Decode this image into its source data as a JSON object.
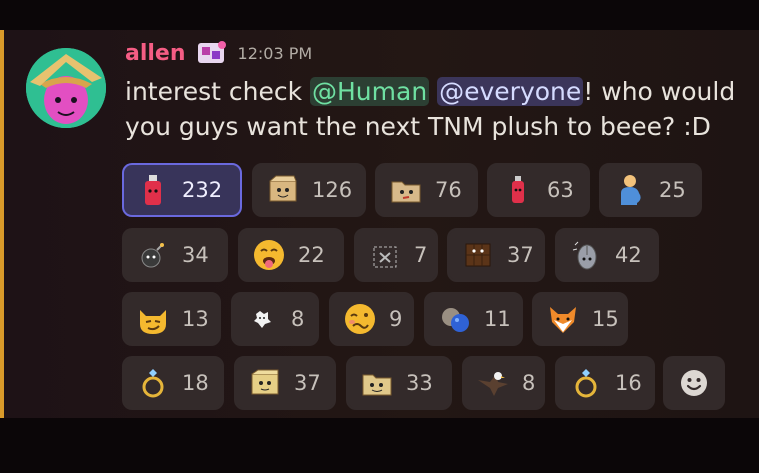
{
  "message": {
    "username": "allen",
    "timestamp": "12:03 PM",
    "text_before": "interest check ",
    "mention_human": "@Human",
    "text_between": " ",
    "mention_everyone": "@everyone",
    "text_after": "! who would you guys want the next TNM plush to beee? :D"
  },
  "colors": {
    "username": "#f55d84",
    "accent_bar": "#d99a2a",
    "selected_reaction_border": "#6a69de"
  },
  "reactions": [
    {
      "emoji": "red-bottle-icon",
      "count": "232",
      "selected": true
    },
    {
      "emoji": "box-character-icon",
      "count": "126"
    },
    {
      "emoji": "folder-character-icon",
      "count": "76"
    },
    {
      "emoji": "red-bottle-small-icon",
      "count": "63"
    },
    {
      "emoji": "pregnant-man-icon",
      "count": "25"
    },
    {
      "emoji": "bomb-character-icon",
      "count": "34"
    },
    {
      "emoji": "drooling-face-icon",
      "count": "22"
    },
    {
      "emoji": "missing-emoji-icon",
      "count": "7"
    },
    {
      "emoji": "chocolate-bar-icon",
      "count": "37"
    },
    {
      "emoji": "mouse-character-icon",
      "count": "42"
    },
    {
      "emoji": "smirking-cat-icon",
      "count": "13"
    },
    {
      "emoji": "white-blob-icon",
      "count": "8"
    },
    {
      "emoji": "woozy-face-icon",
      "count": "9"
    },
    {
      "emoji": "planets-icon",
      "count": "11"
    },
    {
      "emoji": "fox-face-icon",
      "count": "15"
    },
    {
      "emoji": "ring-icon",
      "count": "18"
    },
    {
      "emoji": "box-face-icon",
      "count": "37"
    },
    {
      "emoji": "folder-face-icon",
      "count": "33"
    },
    {
      "emoji": "eagle-icon",
      "count": "8"
    },
    {
      "emoji": "ring-icon",
      "count": "16"
    }
  ],
  "add_reaction": {
    "icon": "smiley-add-icon"
  }
}
